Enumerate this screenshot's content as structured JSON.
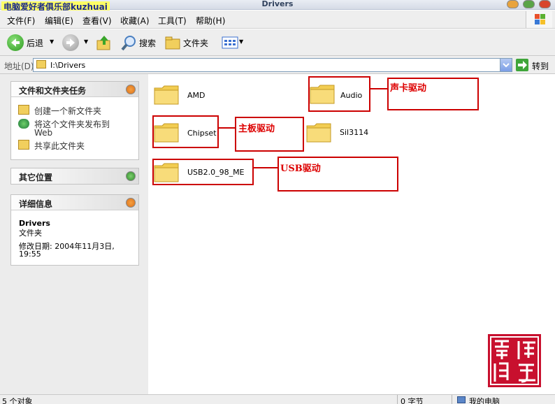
{
  "brand_label": "电脑爱好者俱乐部kuzhuai",
  "window": {
    "title": "Drivers"
  },
  "menu": [
    "文件(F)",
    "编辑(E)",
    "查看(V)",
    "收藏(A)",
    "工具(T)",
    "帮助(H)"
  ],
  "toolbar": {
    "back": "后退",
    "search": "搜索",
    "folders": "文件夹"
  },
  "address": {
    "label": "地址(D)",
    "value": "I:\\Drivers",
    "go": "转到"
  },
  "left": {
    "tasks_title": "文件和文件夹任务",
    "tasks": [
      "创建一个新文件夹",
      "将这个文件夹发布到",
      "Web",
      "共享此文件夹"
    ],
    "other_title": "其它位置",
    "details_title": "详细信息",
    "details": {
      "name": "Drivers",
      "type": "文件夹",
      "modified": "修改日期: 2004年11月3日,",
      "time": "19:55"
    }
  },
  "folders": [
    "AMD",
    "Audio",
    "Chipset",
    "Sil3114",
    "USB2.0_98_ME"
  ],
  "annotations": {
    "audio": "声卡驱动",
    "chipset": "主板驱动",
    "usb": "USB驱动"
  },
  "seal": {
    "text": "電腦傳奇"
  },
  "status": {
    "objects": "5 个对象",
    "size": "0 字节",
    "location": "我的电脑"
  },
  "colors": {
    "annotation": "#cc0000",
    "xp_blue": "#3a6fd0",
    "seal": "#c8102e"
  },
  "icons": [
    "back-arrow-icon",
    "forward-arrow-icon",
    "up-folder-icon",
    "search-icon",
    "folders-icon",
    "views-icon",
    "go-arrow-icon",
    "folder-icon",
    "computer-icon"
  ]
}
